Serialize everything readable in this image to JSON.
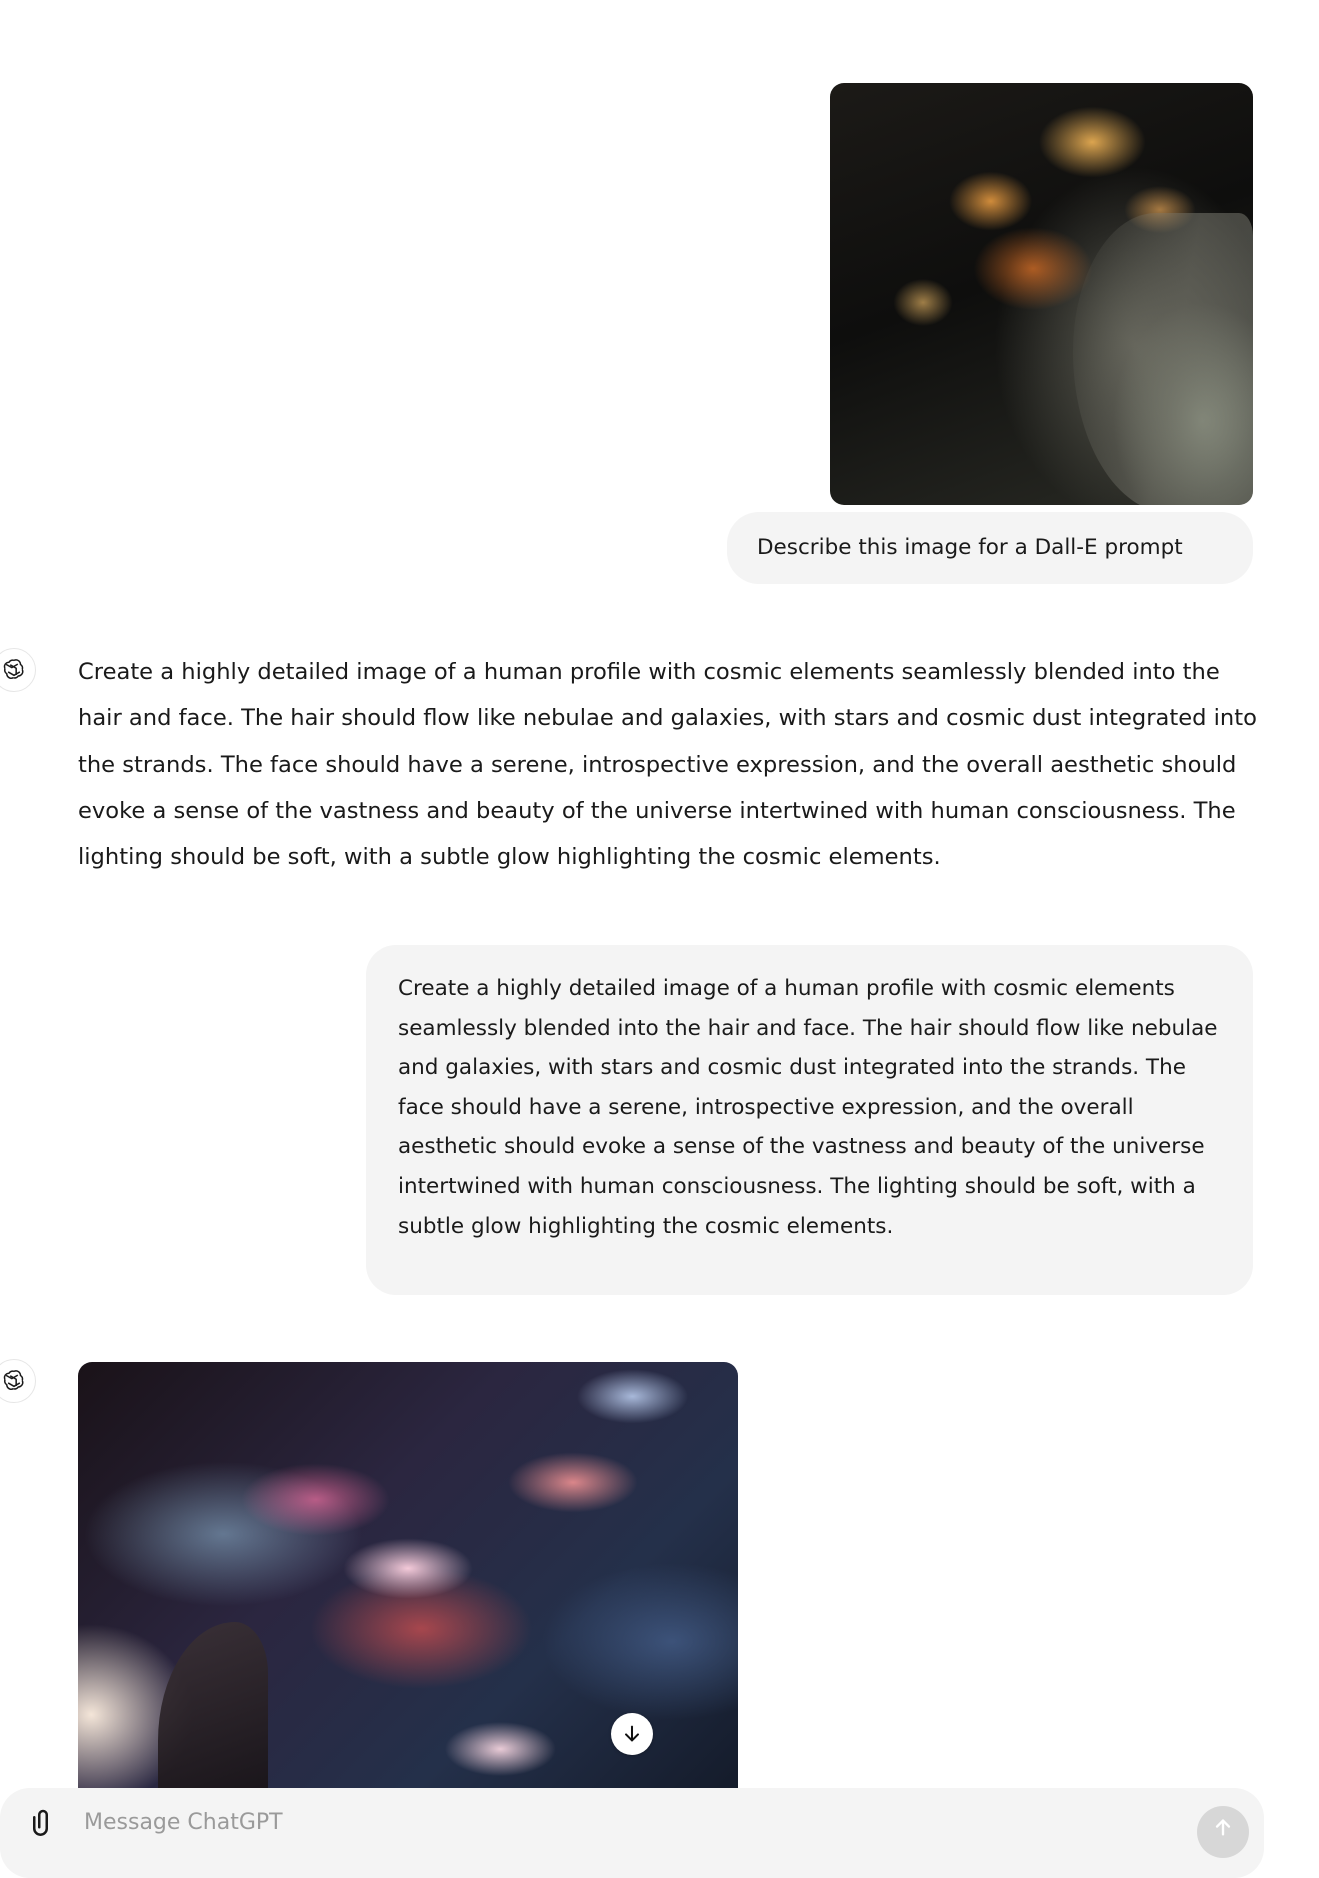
{
  "conversation": {
    "messages": [
      {
        "role": "user",
        "has_image": true,
        "text": "Describe this image for a Dall-E prompt"
      },
      {
        "role": "assistant",
        "text": "Create a highly detailed image of a human profile with cosmic elements seamlessly blended into the hair and face. The hair should flow like nebulae and galaxies, with stars and cosmic dust integrated into the strands. The face should have a serene, introspective expression, and the overall aesthetic should evoke a sense of the vastness and beauty of the universe intertwined with human consciousness. The lighting should be soft, with a subtle glow highlighting the cosmic elements."
      },
      {
        "role": "user",
        "text": "Create a highly detailed image of a human profile with cosmic elements seamlessly blended into the hair and face. The hair should flow like nebulae and galaxies, with stars and cosmic dust integrated into the strands. The face should have a serene, introspective expression, and the overall aesthetic should evoke a sense of the vastness and beauty of the universe intertwined with human consciousness. The lighting should be soft, with a subtle glow highlighting the cosmic elements."
      },
      {
        "role": "assistant",
        "has_image": true,
        "icons": [
          "download-icon"
        ]
      }
    ]
  },
  "composer": {
    "placeholder": "Message ChatGPT",
    "icons": [
      "paperclip-icon",
      "send-arrow-icon"
    ]
  },
  "colors": {
    "user_bubble": "#f4f4f4",
    "text": "#1a1a1a",
    "send_button_disabled": "#d7d7d7"
  }
}
